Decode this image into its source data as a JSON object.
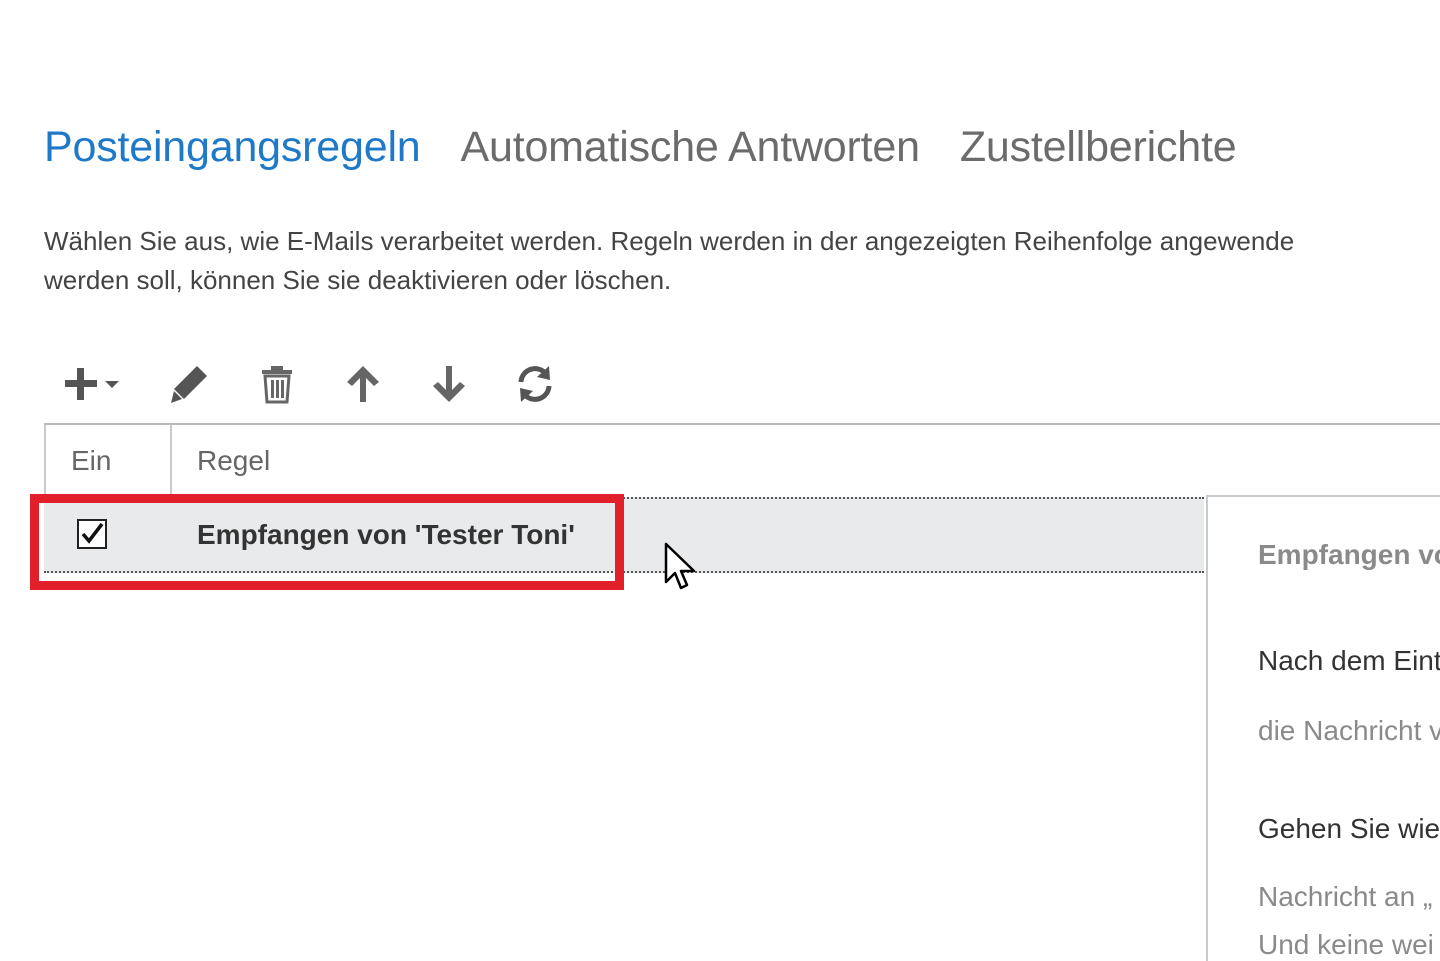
{
  "tabs": [
    {
      "label": "Posteingangsregeln",
      "active": true
    },
    {
      "label": "Automatische Antworten",
      "active": false
    },
    {
      "label": "Zustellberichte",
      "active": false
    }
  ],
  "description": {
    "line1": "Wählen Sie aus, wie E-Mails verarbeitet werden. Regeln werden in der angezeigten Reihenfolge angewende",
    "line2": "werden soll, können Sie sie deaktivieren oder löschen."
  },
  "toolbar": {
    "icons": [
      "plus-icon",
      "chevron-down-icon",
      "pencil-icon",
      "trash-icon",
      "arrow-up-icon",
      "arrow-down-icon",
      "refresh-icon"
    ]
  },
  "table": {
    "columns": [
      "Ein",
      "Regel"
    ],
    "rows": [
      {
        "enabled": true,
        "name": "Empfangen von 'Tester Toni'"
      }
    ]
  },
  "details": {
    "title": "Empfangen vo",
    "condition_label": "Nach dem Eint",
    "condition_value": "die Nachricht v",
    "action_label": "Gehen Sie wie",
    "action_value": "Nachricht an „",
    "extra": "Und keine wei"
  },
  "colors": {
    "accent": "#1e7ac9",
    "highlight": "#e2202a",
    "row_selected": "#e8eaec"
  }
}
